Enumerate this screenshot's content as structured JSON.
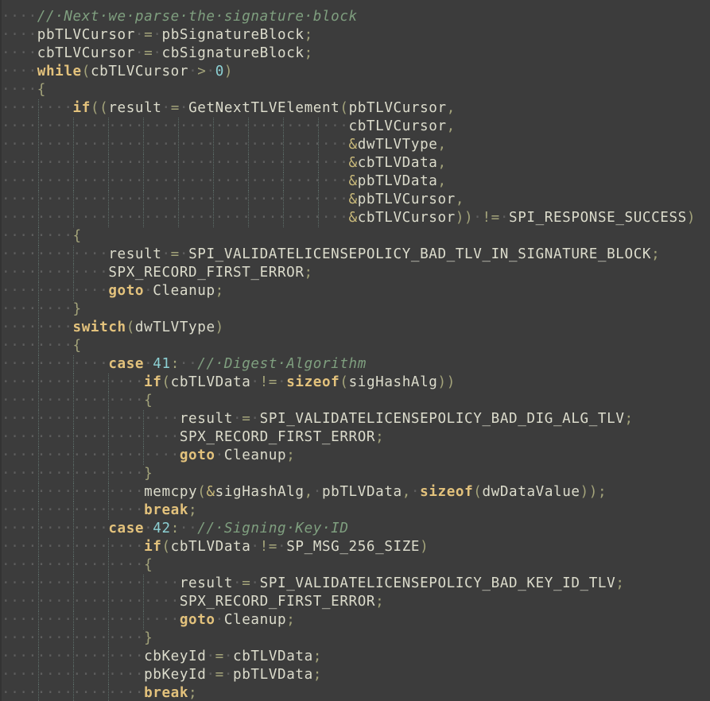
{
  "editor": {
    "language": "C",
    "whitespace_marker": "·",
    "lines": [
      {
        "indent": 1,
        "tokens": [
          [
            "cm",
            "// Next we parse the signature block"
          ]
        ]
      },
      {
        "indent": 1,
        "tokens": [
          [
            "id",
            "pbTLVCursor"
          ],
          [
            "ws",
            " "
          ],
          [
            "op",
            "="
          ],
          [
            "ws",
            " "
          ],
          [
            "id",
            "pbSignatureBlock"
          ],
          [
            "p",
            ";"
          ]
        ]
      },
      {
        "indent": 1,
        "tokens": [
          [
            "id",
            "cbTLVCursor"
          ],
          [
            "ws",
            " "
          ],
          [
            "op",
            "="
          ],
          [
            "ws",
            " "
          ],
          [
            "id",
            "cbSignatureBlock"
          ],
          [
            "p",
            ";"
          ]
        ]
      },
      {
        "indent": 1,
        "tokens": [
          [
            "kw",
            "while"
          ],
          [
            "p",
            "("
          ],
          [
            "id",
            "cbTLVCursor"
          ],
          [
            "ws",
            " "
          ],
          [
            "op",
            ">"
          ],
          [
            "ws",
            " "
          ],
          [
            "num",
            "0"
          ],
          [
            "p",
            ")"
          ]
        ]
      },
      {
        "indent": 1,
        "tokens": [
          [
            "p",
            "{"
          ]
        ]
      },
      {
        "indent": 2,
        "tokens": [
          [
            "kw",
            "if"
          ],
          [
            "p",
            "(("
          ],
          [
            "id",
            "result"
          ],
          [
            "ws",
            " "
          ],
          [
            "op",
            "="
          ],
          [
            "ws",
            " "
          ],
          [
            "id",
            "GetNextTLVElement"
          ],
          [
            "p",
            "("
          ],
          [
            "id",
            "pbTLVCursor"
          ],
          [
            "p",
            ","
          ]
        ]
      },
      {
        "indent": 2,
        "pad": 31,
        "tokens": [
          [
            "id",
            "cbTLVCursor"
          ],
          [
            "p",
            ","
          ]
        ]
      },
      {
        "indent": 2,
        "pad": 31,
        "tokens": [
          [
            "amp",
            "&"
          ],
          [
            "id",
            "dwTLVType"
          ],
          [
            "p",
            ","
          ]
        ]
      },
      {
        "indent": 2,
        "pad": 31,
        "tokens": [
          [
            "amp",
            "&"
          ],
          [
            "id",
            "cbTLVData"
          ],
          [
            "p",
            ","
          ]
        ]
      },
      {
        "indent": 2,
        "pad": 31,
        "tokens": [
          [
            "amp",
            "&"
          ],
          [
            "id",
            "pbTLVData"
          ],
          [
            "p",
            ","
          ]
        ]
      },
      {
        "indent": 2,
        "pad": 31,
        "tokens": [
          [
            "amp",
            "&"
          ],
          [
            "id",
            "pbTLVCursor"
          ],
          [
            "p",
            ","
          ]
        ]
      },
      {
        "indent": 2,
        "pad": 31,
        "tokens": [
          [
            "amp",
            "&"
          ],
          [
            "id",
            "cbTLVCursor"
          ],
          [
            "p",
            "))"
          ],
          [
            "ws",
            " "
          ],
          [
            "op",
            "!="
          ],
          [
            "ws",
            " "
          ],
          [
            "id",
            "SPI_RESPONSE_SUCCESS"
          ],
          [
            "p",
            ")"
          ]
        ]
      },
      {
        "indent": 2,
        "tokens": [
          [
            "p",
            "{"
          ]
        ]
      },
      {
        "indent": 3,
        "tokens": [
          [
            "id",
            "result"
          ],
          [
            "ws",
            " "
          ],
          [
            "op",
            "="
          ],
          [
            "ws",
            " "
          ],
          [
            "id",
            "SPI_VALIDATELICENSEPOLICY_BAD_TLV_IN_SIGNATURE_BLOCK"
          ],
          [
            "p",
            ";"
          ]
        ]
      },
      {
        "indent": 3,
        "tokens": [
          [
            "id",
            "SPX_RECORD_FIRST_ERROR"
          ],
          [
            "p",
            ";"
          ]
        ]
      },
      {
        "indent": 3,
        "tokens": [
          [
            "kw",
            "goto"
          ],
          [
            "ws",
            " "
          ],
          [
            "id",
            "Cleanup"
          ],
          [
            "p",
            ";"
          ]
        ]
      },
      {
        "indent": 2,
        "tokens": [
          [
            "p",
            "}"
          ]
        ]
      },
      {
        "indent": 2,
        "tokens": [
          [
            "kw",
            "switch"
          ],
          [
            "p",
            "("
          ],
          [
            "id",
            "dwTLVType"
          ],
          [
            "p",
            ")"
          ]
        ]
      },
      {
        "indent": 2,
        "tokens": [
          [
            "p",
            "{"
          ]
        ]
      },
      {
        "indent": 3,
        "tokens": [
          [
            "kw",
            "case"
          ],
          [
            "ws",
            " "
          ],
          [
            "num",
            "41"
          ],
          [
            "p",
            ":"
          ],
          [
            "ws",
            "  "
          ],
          [
            "cm",
            "// Digest Algorithm"
          ]
        ]
      },
      {
        "indent": 4,
        "tokens": [
          [
            "kw",
            "if"
          ],
          [
            "p",
            "("
          ],
          [
            "id",
            "cbTLVData"
          ],
          [
            "ws",
            " "
          ],
          [
            "op",
            "!="
          ],
          [
            "ws",
            " "
          ],
          [
            "kw",
            "sizeof"
          ],
          [
            "p",
            "("
          ],
          [
            "id",
            "sigHashAlg"
          ],
          [
            "p",
            "))"
          ]
        ]
      },
      {
        "indent": 4,
        "tokens": [
          [
            "p",
            "{"
          ]
        ]
      },
      {
        "indent": 5,
        "tokens": [
          [
            "id",
            "result"
          ],
          [
            "ws",
            " "
          ],
          [
            "op",
            "="
          ],
          [
            "ws",
            " "
          ],
          [
            "id",
            "SPI_VALIDATELICENSEPOLICY_BAD_DIG_ALG_TLV"
          ],
          [
            "p",
            ";"
          ]
        ]
      },
      {
        "indent": 5,
        "tokens": [
          [
            "id",
            "SPX_RECORD_FIRST_ERROR"
          ],
          [
            "p",
            ";"
          ]
        ]
      },
      {
        "indent": 5,
        "tokens": [
          [
            "kw",
            "goto"
          ],
          [
            "ws",
            " "
          ],
          [
            "id",
            "Cleanup"
          ],
          [
            "p",
            ";"
          ]
        ]
      },
      {
        "indent": 4,
        "tokens": [
          [
            "p",
            "}"
          ]
        ]
      },
      {
        "indent": 4,
        "tokens": [
          [
            "id",
            "memcpy"
          ],
          [
            "p",
            "("
          ],
          [
            "amp",
            "&"
          ],
          [
            "id",
            "sigHashAlg"
          ],
          [
            "p",
            ","
          ],
          [
            "ws",
            " "
          ],
          [
            "id",
            "pbTLVData"
          ],
          [
            "p",
            ","
          ],
          [
            "ws",
            " "
          ],
          [
            "kw",
            "sizeof"
          ],
          [
            "p",
            "("
          ],
          [
            "id",
            "dwDataValue"
          ],
          [
            "p",
            "));"
          ]
        ]
      },
      {
        "indent": 4,
        "tokens": [
          [
            "kw",
            "break"
          ],
          [
            "p",
            ";"
          ]
        ]
      },
      {
        "indent": 3,
        "tokens": [
          [
            "kw",
            "case"
          ],
          [
            "ws",
            " "
          ],
          [
            "num",
            "42"
          ],
          [
            "p",
            ":"
          ],
          [
            "ws",
            "  "
          ],
          [
            "cm",
            "// Signing Key ID"
          ]
        ]
      },
      {
        "indent": 4,
        "tokens": [
          [
            "kw",
            "if"
          ],
          [
            "p",
            "("
          ],
          [
            "id",
            "cbTLVData"
          ],
          [
            "ws",
            " "
          ],
          [
            "op",
            "!="
          ],
          [
            "ws",
            " "
          ],
          [
            "id",
            "SP_MSG_256_SIZE"
          ],
          [
            "p",
            ")"
          ]
        ]
      },
      {
        "indent": 4,
        "tokens": [
          [
            "p",
            "{"
          ]
        ]
      },
      {
        "indent": 5,
        "tokens": [
          [
            "id",
            "result"
          ],
          [
            "ws",
            " "
          ],
          [
            "op",
            "="
          ],
          [
            "ws",
            " "
          ],
          [
            "id",
            "SPI_VALIDATELICENSEPOLICY_BAD_KEY_ID_TLV"
          ],
          [
            "p",
            ";"
          ]
        ]
      },
      {
        "indent": 5,
        "tokens": [
          [
            "id",
            "SPX_RECORD_FIRST_ERROR"
          ],
          [
            "p",
            ";"
          ]
        ]
      },
      {
        "indent": 5,
        "tokens": [
          [
            "kw",
            "goto"
          ],
          [
            "ws",
            " "
          ],
          [
            "id",
            "Cleanup"
          ],
          [
            "p",
            ";"
          ]
        ]
      },
      {
        "indent": 4,
        "tokens": [
          [
            "p",
            "}"
          ]
        ]
      },
      {
        "indent": 4,
        "tokens": [
          [
            "id",
            "cbKeyId"
          ],
          [
            "ws",
            " "
          ],
          [
            "op",
            "="
          ],
          [
            "ws",
            " "
          ],
          [
            "id",
            "cbTLVData"
          ],
          [
            "p",
            ";"
          ]
        ]
      },
      {
        "indent": 4,
        "tokens": [
          [
            "id",
            "pbKeyId"
          ],
          [
            "ws",
            " "
          ],
          [
            "op",
            "="
          ],
          [
            "ws",
            " "
          ],
          [
            "id",
            "pbTLVData"
          ],
          [
            "p",
            ";"
          ]
        ]
      },
      {
        "indent": 4,
        "tokens": [
          [
            "kw",
            "break"
          ],
          [
            "p",
            ";"
          ]
        ]
      }
    ]
  }
}
